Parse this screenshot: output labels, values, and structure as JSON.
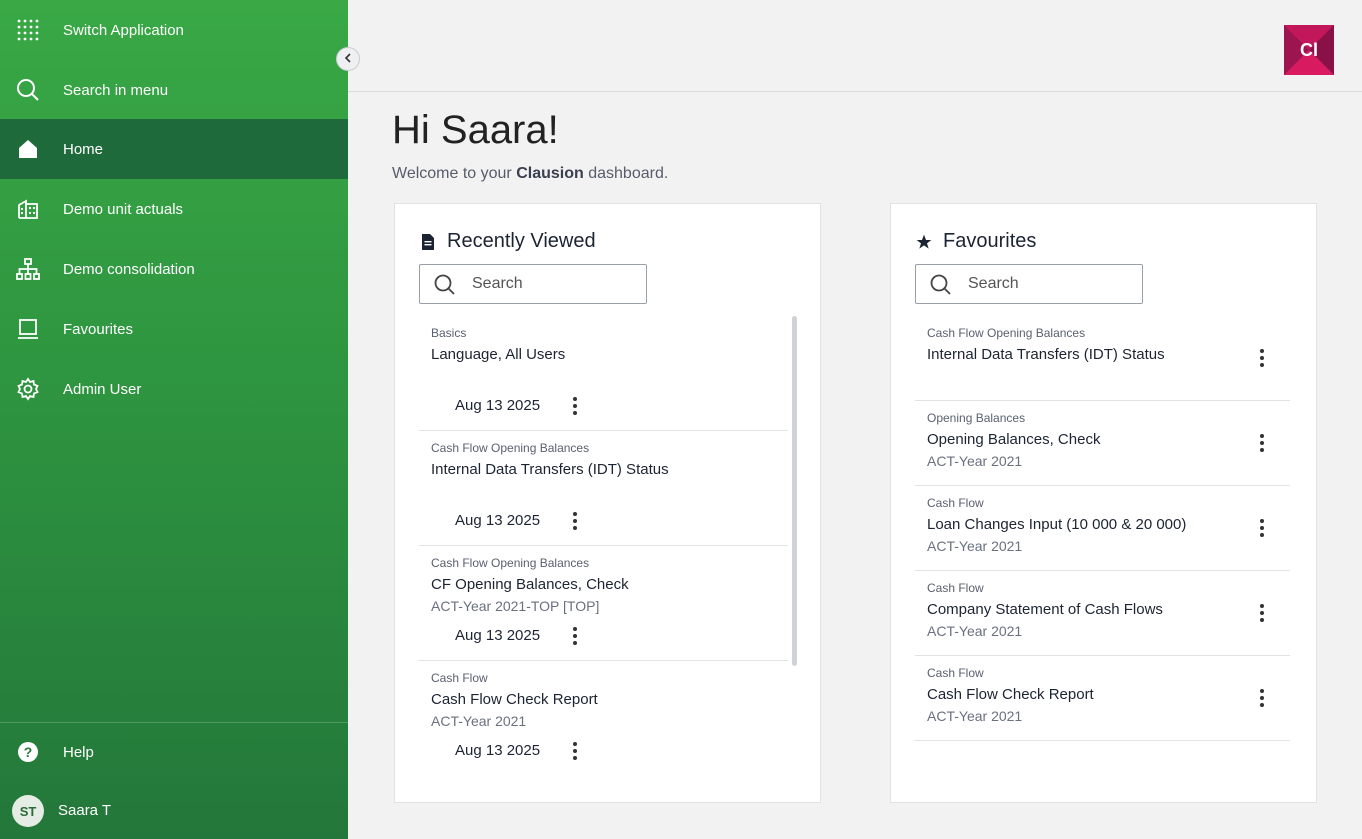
{
  "sidebar": {
    "items": [
      {
        "label": "Switch Application",
        "icon": "grid-icon"
      },
      {
        "label": "Search in menu",
        "icon": "search-icon"
      },
      {
        "label": "Home",
        "icon": "home-icon",
        "active": true
      },
      {
        "label": "Demo unit actuals",
        "icon": "building-icon"
      },
      {
        "label": "Demo consolidation",
        "icon": "hierarchy-icon"
      },
      {
        "label": "Favourites",
        "icon": "laptop-icon"
      },
      {
        "label": "Admin User",
        "icon": "gear-icon"
      }
    ],
    "help_label": "Help",
    "user_initials": "ST",
    "user_name": "Saara T"
  },
  "header": {
    "logo_text": "Cl"
  },
  "greeting": "Hi Saara!",
  "welcome": {
    "prefix": "Welcome to your",
    "brand": "Clausion",
    "suffix": "dashboard."
  },
  "recently_viewed": {
    "title": "Recently Viewed",
    "search_placeholder": "Search",
    "items": [
      {
        "category": "Basics",
        "title": "Language, All Users",
        "subtitle": "",
        "date": "Aug 13 2025"
      },
      {
        "category": "Cash Flow Opening Balances",
        "title": "Internal Data Transfers (IDT) Status",
        "subtitle": "",
        "date": "Aug 13 2025"
      },
      {
        "category": "Cash Flow Opening Balances",
        "title": "CF Opening Balances, Check",
        "subtitle": "ACT-Year 2021-TOP [TOP]",
        "date": "Aug 13 2025"
      },
      {
        "category": "Cash Flow",
        "title": "Cash Flow Check Report",
        "subtitle": "ACT-Year 2021",
        "date": "Aug 13 2025"
      }
    ]
  },
  "favourites": {
    "title": "Favourites",
    "search_placeholder": "Search",
    "items": [
      {
        "category": "Cash Flow Opening Balances",
        "title": "Internal Data Transfers (IDT) Status",
        "subtitle": ""
      },
      {
        "category": "Opening Balances",
        "title": "Opening Balances, Check",
        "subtitle": "ACT-Year 2021"
      },
      {
        "category": "Cash Flow",
        "title": "Loan Changes Input (10 000 & 20 000)",
        "subtitle": "ACT-Year 2021"
      },
      {
        "category": "Cash Flow",
        "title": "Company Statement of Cash Flows",
        "subtitle": "ACT-Year 2021"
      },
      {
        "category": "Cash Flow",
        "title": "Cash Flow Check Report",
        "subtitle": "ACT-Year 2021"
      }
    ]
  },
  "colors": {
    "sidebar_top": "#39a845",
    "sidebar_active": "#1f6a3b",
    "logo": "#c2185b"
  }
}
